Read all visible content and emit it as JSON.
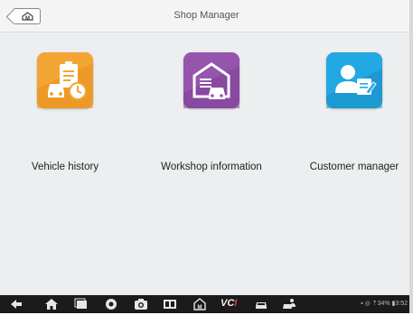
{
  "header": {
    "title": "Shop Manager",
    "home_icon": "home-m-icon"
  },
  "apps": [
    {
      "label": "Vehicle history",
      "icon": "vehicle-history-icon",
      "color": "#f0a030"
    },
    {
      "label": "Workshop information",
      "icon": "workshop-icon",
      "color": "#8e4fa5"
    },
    {
      "label": "Customer manager",
      "icon": "customer-icon",
      "color": "#1fa3e0"
    }
  ],
  "navbar": {
    "vci_label": "VC",
    "vci_accent": "I",
    "status_text": "▪ ◎ ⇡34% ▮3:52"
  }
}
